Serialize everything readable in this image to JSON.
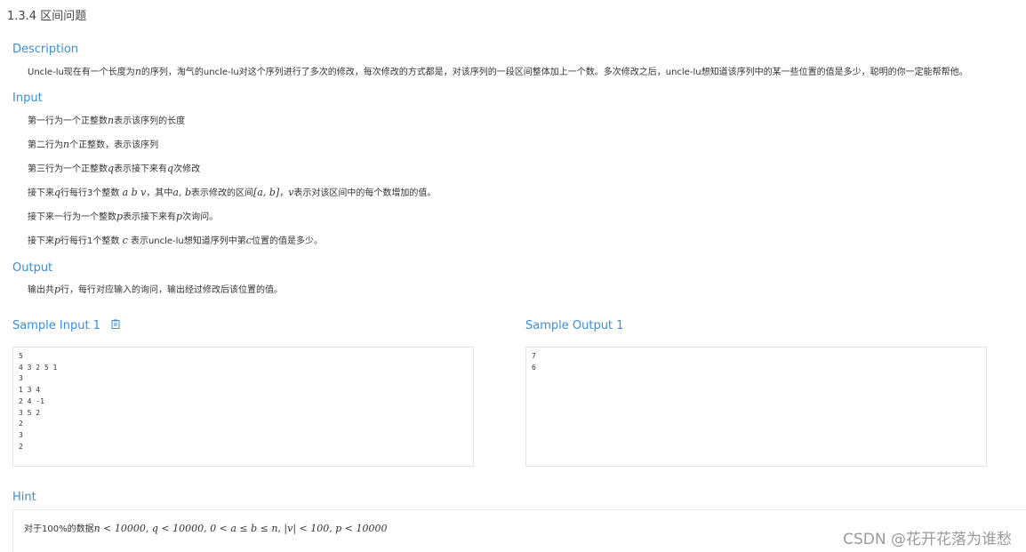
{
  "title": "1.3.4 区间问题",
  "description": {
    "heading": "Description",
    "text_pre": "Uncle-lu现在有一个长度为",
    "text_n": "n",
    "text_post": "的序列，淘气的uncle-lu对这个序列进行了多次的修改，每次修改的方式都是，对该序列的一段区间整体加上一个数。多次修改之后，uncle-lu想知道该序列中的某一些位置的值是多少，聪明的你一定能帮帮他。"
  },
  "input": {
    "heading": "Input",
    "line1": {
      "pre": "第一行为一个正整数",
      "var": "n",
      "post": "表示该序列的长度"
    },
    "line2": {
      "pre": "第二行为",
      "var": "n",
      "post": "个正整数，表示该序列"
    },
    "line3": {
      "pre": "第三行为一个正整数",
      "var": "q",
      "post": "表示接下来有",
      "var2": "q",
      "post2": "次修改"
    },
    "line4": {
      "pre": "接下来",
      "var": "q",
      "mid": "行每行3个整数 ",
      "vars": "a b v",
      "mid2": "，其中",
      "ab": "a, b",
      "mid3": "表示修改的区间",
      "interval": "[a, b]",
      "mid4": "，",
      "v": "v",
      "post": "表示对该区间中的每个数增加的值。"
    },
    "line5": {
      "pre": "接下来一行为一个整数",
      "var": "p",
      "post": "表示接下来有",
      "var2": "p",
      "post2": "次询问。"
    },
    "line6": {
      "pre": "接下来",
      "var": "p",
      "mid": "行每行1个整数 ",
      "c": "c",
      "mid2": " 表示uncle-lu想知道序列中第",
      "c2": "c",
      "post": "位置的值是多少。"
    }
  },
  "output": {
    "heading": "Output",
    "pre": "输出共",
    "var": "p",
    "post": "行，每行对应输入的询问，输出经过修改后该位置的值。"
  },
  "sample_input": {
    "heading": "Sample Input 1",
    "icon": "copy-icon",
    "lines": [
      "5",
      "4 3 2 5 1",
      "3",
      "1 3 4",
      "2 4 -1",
      "3 5 2",
      "2",
      "3",
      "2"
    ]
  },
  "sample_output": {
    "heading": "Sample Output 1",
    "lines": [
      "7",
      "6"
    ]
  },
  "hint": {
    "heading": "Hint",
    "pre": "对于100%的数据",
    "math": "n < 10000, q < 10000, 0 < a ≤ b ≤ n, |v| < 100, p < 10000"
  },
  "watermark": "CSDN @花开花落为谁愁",
  "colors": {
    "heading": "#3b8ed6",
    "text": "#333333",
    "border": "#e4e4e4",
    "watermark": "#9a9a9a"
  }
}
